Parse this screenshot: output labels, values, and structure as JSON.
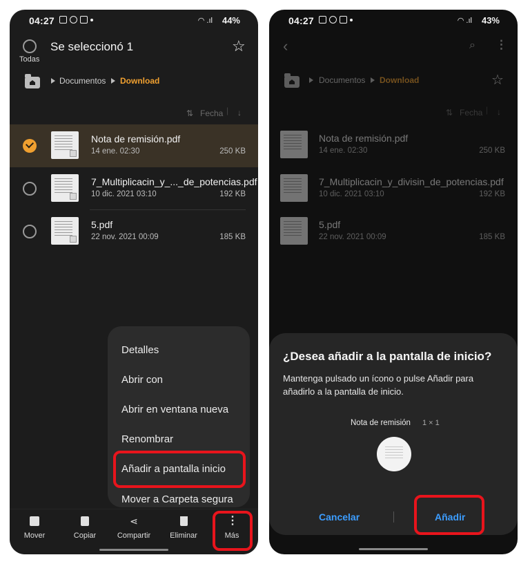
{
  "left": {
    "status": {
      "time": "04:27",
      "battery": "44%"
    },
    "header": {
      "select_all_label": "Todas",
      "title": "Se seleccionó 1"
    },
    "breadcrumb": {
      "parent": "Documentos",
      "current": "Download"
    },
    "sort": {
      "label": "Fecha"
    },
    "files": [
      {
        "name": "Nota de remisión.pdf",
        "date": "14 ene. 02:30",
        "size": "250 KB",
        "selected": true
      },
      {
        "name": "7_Multiplicacin_y_..._de_potencias.pdf",
        "date": "10 dic. 2021 03:10",
        "size": "192 KB",
        "selected": false
      },
      {
        "name": "5.pdf",
        "date": "22 nov. 2021 00:09",
        "size": "185 KB",
        "selected": false
      }
    ],
    "menu": {
      "items": [
        "Detalles",
        "Abrir con",
        "Abrir en ventana nueva",
        "Renombrar",
        "Añadir a pantalla inicio",
        "Mover a Carpeta segura"
      ]
    },
    "bottom_bar": {
      "items": [
        {
          "label": "Mover",
          "icon": "move-icon"
        },
        {
          "label": "Copiar",
          "icon": "copy-icon"
        },
        {
          "label": "Compartir",
          "icon": "share-icon"
        },
        {
          "label": "Eliminar",
          "icon": "trash-icon"
        },
        {
          "label": "Más",
          "icon": "more-icon"
        }
      ]
    }
  },
  "right": {
    "status": {
      "time": "04:27",
      "battery": "43%"
    },
    "breadcrumb": {
      "parent": "Documentos",
      "current": "Download"
    },
    "sort": {
      "label": "Fecha"
    },
    "files": [
      {
        "name": "Nota de remisión.pdf",
        "date": "14 ene. 02:30",
        "size": "250 KB"
      },
      {
        "name": "7_Multiplicacin_y_divisin_de_potencias.pdf",
        "date": "10 dic. 2021 03:10",
        "size": "192 KB"
      },
      {
        "name": "5.pdf",
        "date": "22 nov. 2021 00:09",
        "size": "185 KB"
      }
    ],
    "dialog": {
      "title": "¿Desea añadir a la pantalla de inicio?",
      "message": "Mantenga pulsado un ícono o pulse Añadir para añadirlo a la pantalla de inicio.",
      "widget_name": "Nota de remisión",
      "widget_size": "1 × 1",
      "cancel_label": "Cancelar",
      "add_label": "Añadir"
    }
  },
  "colors": {
    "accent": "#f0a030",
    "highlight": "#e8141c",
    "link": "#3c9dff"
  }
}
